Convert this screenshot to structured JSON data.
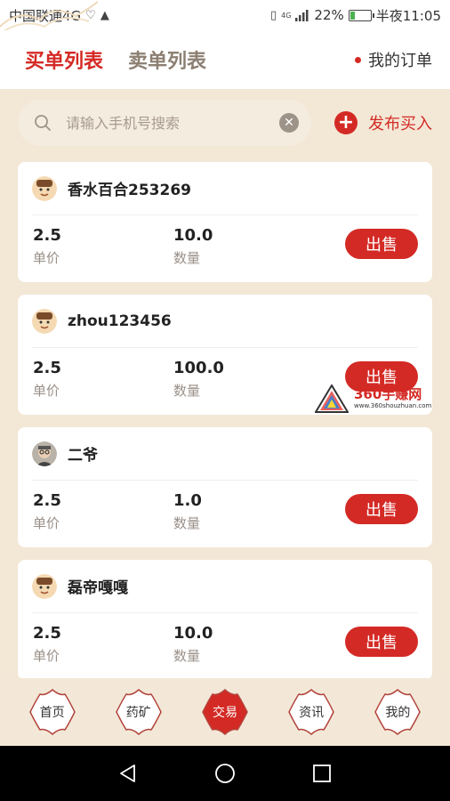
{
  "status_bar": {
    "carrier": "中国联通4G",
    "network": "4G",
    "battery": "22%",
    "battery_level": 0.22,
    "time": "半夜11:05"
  },
  "header": {
    "tabs": [
      {
        "label": "买单列表",
        "active": true
      },
      {
        "label": "卖单列表",
        "active": false
      }
    ],
    "my_orders": "我的订单"
  },
  "search": {
    "placeholder": "请输入手机号搜索",
    "value": ""
  },
  "publish_label": "发布买入",
  "labels": {
    "price": "单价",
    "quantity": "数量",
    "sell": "出售"
  },
  "orders": [
    {
      "username": "香水百合253269",
      "price": "2.5",
      "quantity": "10.0",
      "avatar": "cartoon-avatar"
    },
    {
      "username": "zhou123456",
      "price": "2.5",
      "quantity": "100.0",
      "avatar": "cartoon-avatar"
    },
    {
      "username": "二爷",
      "price": "2.5",
      "quantity": "1.0",
      "avatar": "photo-avatar"
    },
    {
      "username": "磊帝嘎嘎",
      "price": "2.5",
      "quantity": "10.0",
      "avatar": "cartoon-avatar"
    }
  ],
  "watermark": {
    "title": "360手赚网",
    "url": "www.360shouzhuan.com"
  },
  "bottom_nav": [
    {
      "label": "首页",
      "active": false
    },
    {
      "label": "药矿",
      "active": false
    },
    {
      "label": "交易",
      "active": true
    },
    {
      "label": "资讯",
      "active": false
    },
    {
      "label": "我的",
      "active": false
    }
  ],
  "colors": {
    "accent": "#d42a25",
    "background": "#f3e7d6",
    "inactive_tab": "#8c7f72"
  }
}
